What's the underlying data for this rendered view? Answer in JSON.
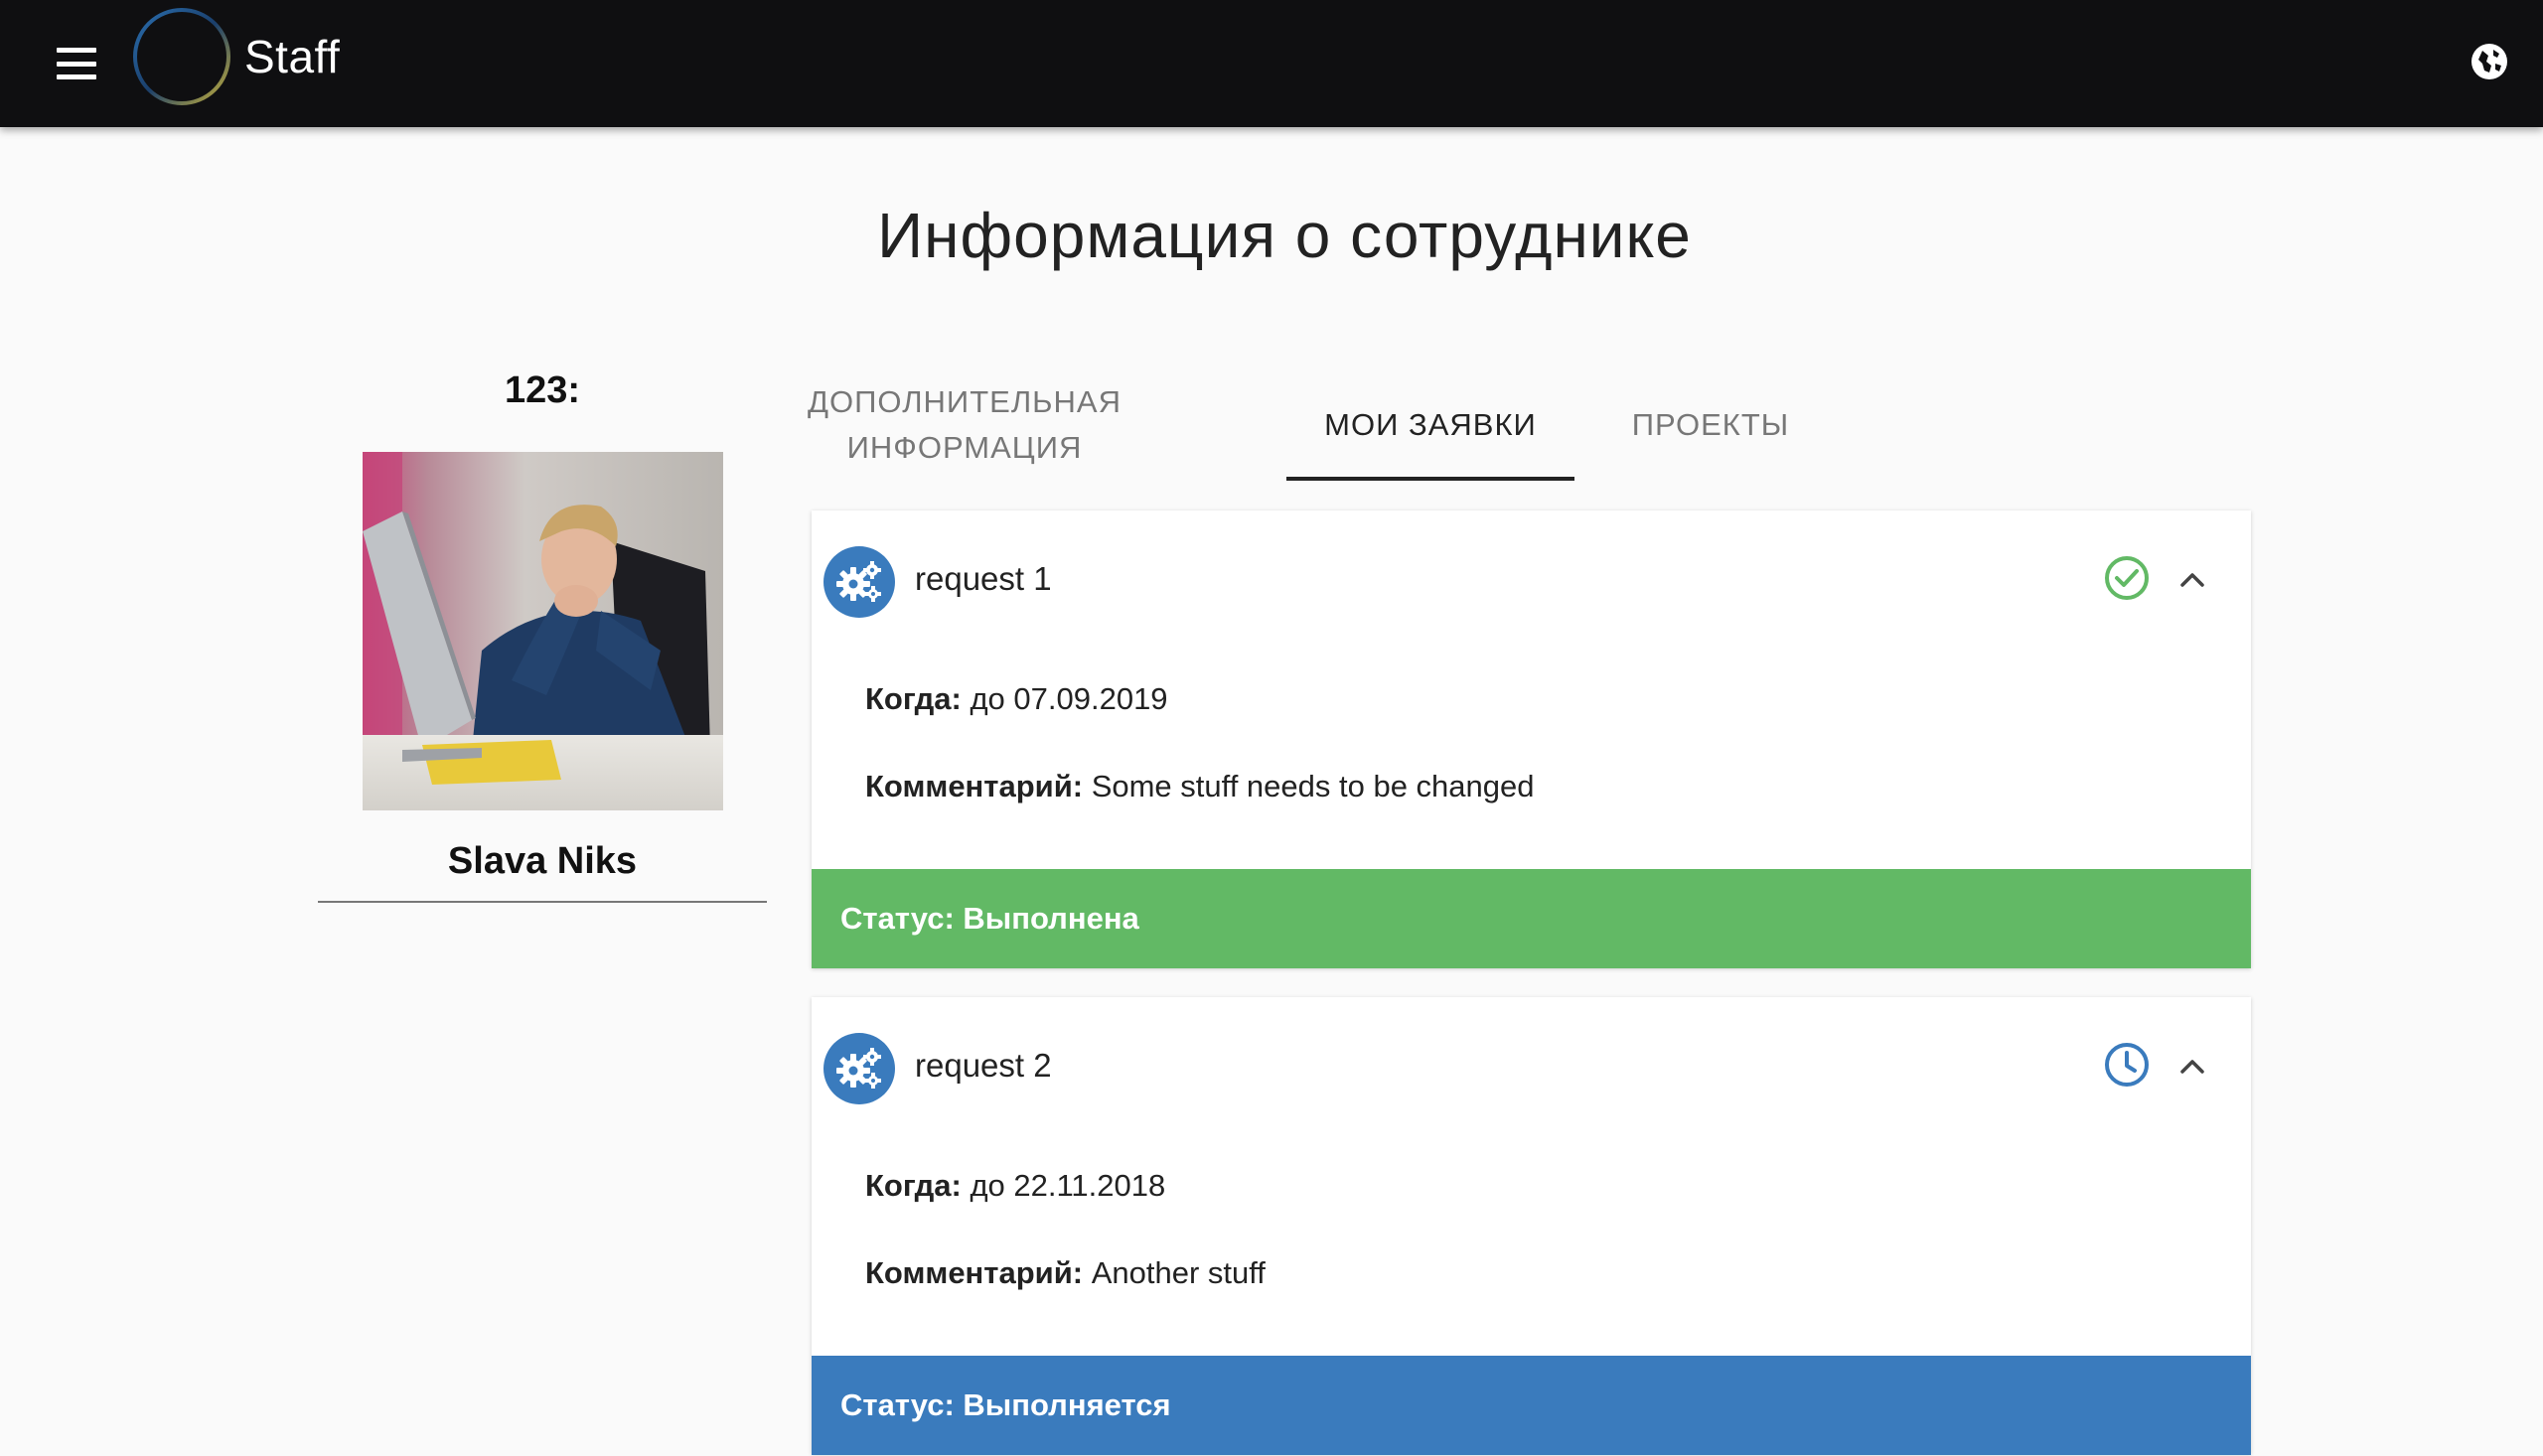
{
  "app": {
    "title": "Staff"
  },
  "page": {
    "title": "Информация о сотруднике"
  },
  "profile": {
    "id_label": "123:",
    "name": "Slava Niks"
  },
  "tabs": [
    {
      "label": "ДОПОЛНИТЕЛЬНАЯ ИНФОРМАЦИЯ",
      "active": false
    },
    {
      "label": "МОИ ЗАЯВКИ",
      "active": true
    },
    {
      "label": "ПРОЕКТЫ",
      "active": false
    }
  ],
  "requests": [
    {
      "title": "request 1",
      "when_label": "Когда:",
      "when_value": "до 07.09.2019",
      "comment_label": "Комментарий:",
      "comment_value": "Some stuff needs to be changed",
      "status_text": "Статус: Выполнена",
      "status_icon": "check-circle-icon",
      "status_color": "#62b965"
    },
    {
      "title": "request 2",
      "when_label": "Когда:",
      "when_value": "до 22.11.2018",
      "comment_label": "Комментарий:",
      "comment_value": "Another stuff",
      "status_text": "Статус: Выполняется",
      "status_icon": "clock-icon",
      "status_color": "#3a7bbd"
    }
  ],
  "colors": {
    "topbar": "#0f0f11",
    "accent_blue": "#3a7bbd",
    "accent_green": "#62b965"
  }
}
